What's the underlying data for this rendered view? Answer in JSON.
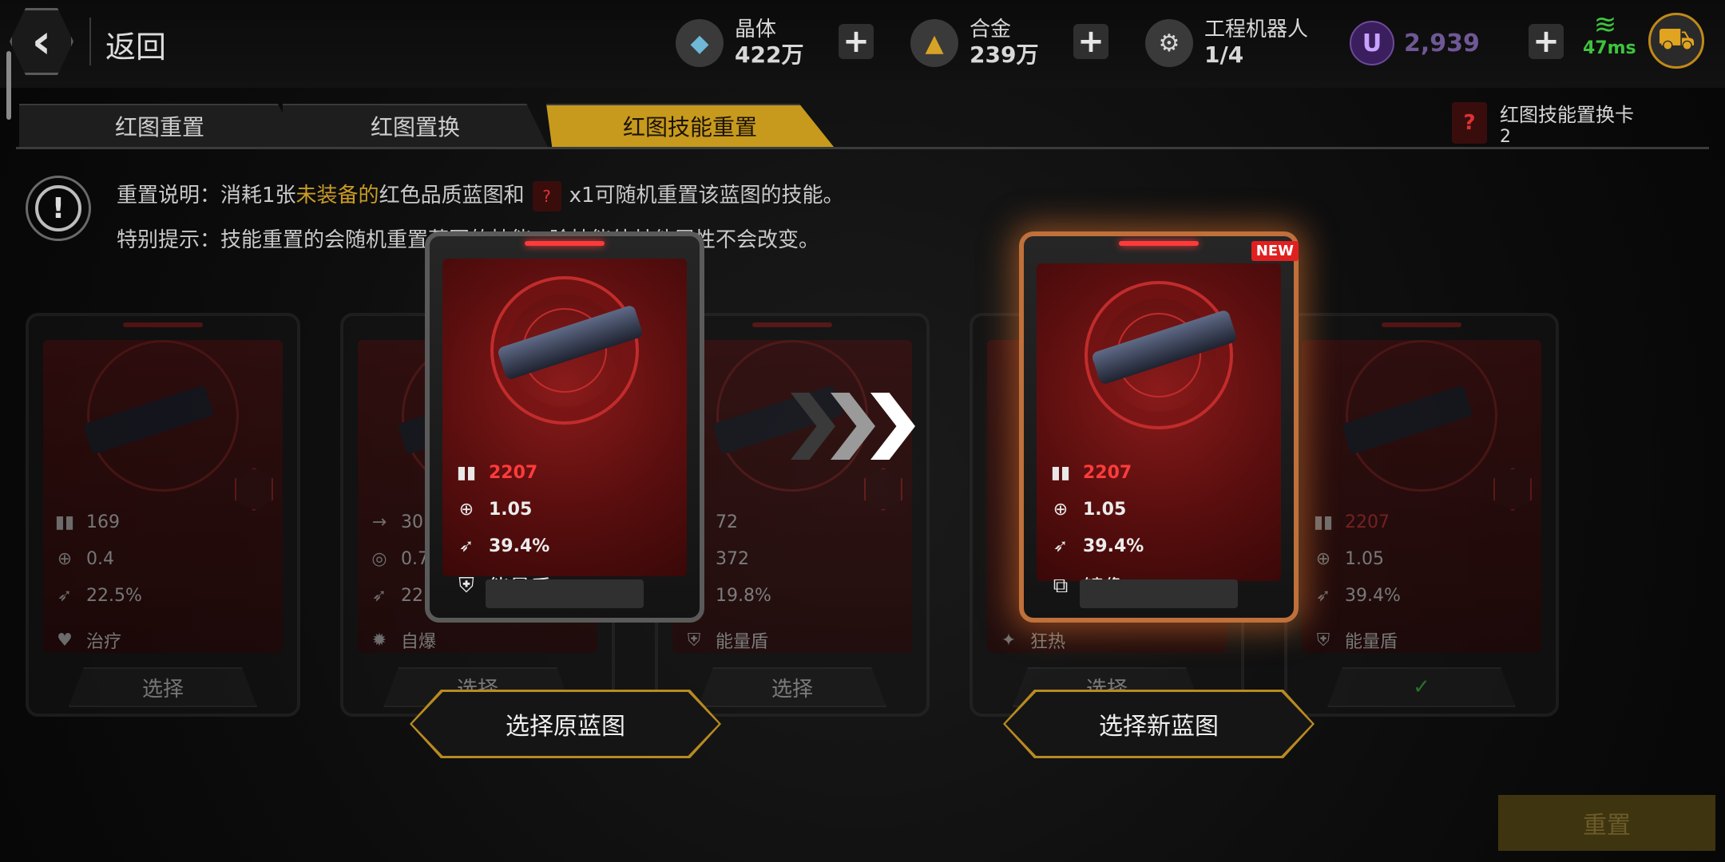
{
  "header": {
    "back_label": "返回",
    "resources": [
      {
        "name": "晶体",
        "value": "422万",
        "icon": "crystal-icon"
      },
      {
        "name": "合金",
        "value": "239万",
        "icon": "alloy-icon"
      },
      {
        "name": "工程机器人",
        "value": "1/4",
        "icon": "robot-icon"
      }
    ],
    "currency_u": {
      "symbol": "U",
      "value": "2,939"
    },
    "plus": "+",
    "ping": "47ms"
  },
  "tabs": [
    {
      "label": "红图重置",
      "active": false
    },
    {
      "label": "红图置换",
      "active": false
    },
    {
      "label": "红图技能重置",
      "active": true
    }
  ],
  "card_counter": {
    "name": "红图技能置换卡",
    "value": "2"
  },
  "description": {
    "line1_prefix": "重置说明：消耗1张",
    "line1_highlight": "未装备的",
    "line1_mid": "红色品质蓝图和",
    "line1_suffix": "x1可随机重置该蓝图的技能。",
    "line2_visible": "特别提示：技能重置的会随机重置蓝图的技能",
    "line2_tail": "除技能外其他属性不会改变。"
  },
  "background_cards": [
    {
      "stats": [
        "169",
        "0.4",
        "22.5%"
      ],
      "skill": "治疗",
      "select": "选择",
      "stat_red": false,
      "selected": false
    },
    {
      "stats": [
        "30",
        "0.7",
        "22"
      ],
      "skill": "自爆",
      "select": "选择",
      "stat_red": false,
      "selected": false
    },
    {
      "stats": [
        "72",
        "372",
        "19.8%"
      ],
      "skill": "能量盾",
      "select": "选择",
      "stat_red": false,
      "selected": false
    },
    {
      "stats": [
        "",
        "",
        ""
      ],
      "skill": "狂热",
      "select": "选择",
      "stat_red": false,
      "selected": false
    },
    {
      "stats": [
        "2207",
        "1.05",
        "39.4%"
      ],
      "skill": "能量盾",
      "select": "✓",
      "stat_red": true,
      "selected": true
    }
  ],
  "original_card": {
    "damage": "2207",
    "rate": "1.05",
    "crit": "39.4%",
    "skill": "能量盾"
  },
  "new_card": {
    "badge": "NEW",
    "damage": "2207",
    "rate": "1.05",
    "crit": "39.4%",
    "skill": "镜像"
  },
  "buttons": {
    "select_original": "选择原蓝图",
    "select_new": "选择新蓝图",
    "reset": "重置"
  },
  "colors": {
    "accent": "#c79a1d",
    "red": "#ff3b3b",
    "new_glow": "#e07430",
    "ping": "#3ec43e"
  }
}
